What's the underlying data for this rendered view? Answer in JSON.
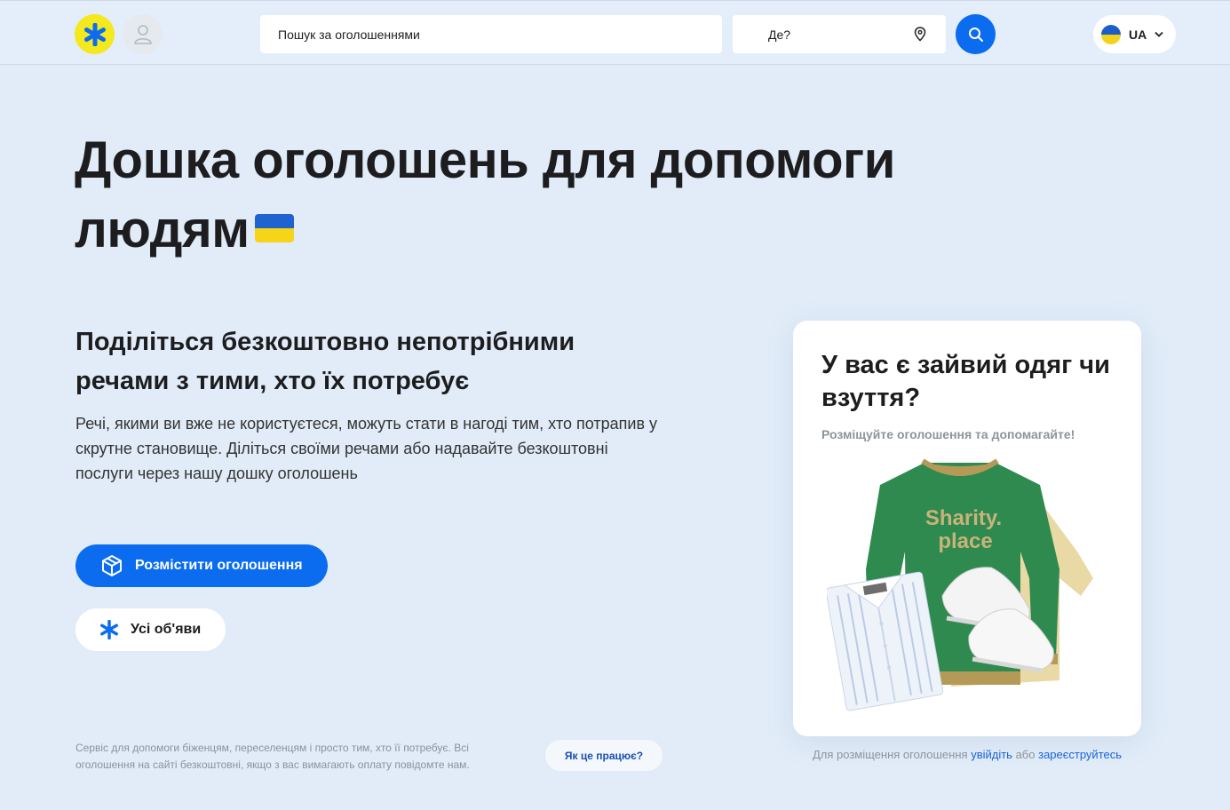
{
  "header": {
    "search_placeholder": "Пошук за оголошеннями",
    "location_placeholder": "Де?",
    "language": "UA",
    "icons": {
      "logo": "asterisk-logo-icon",
      "user": "user-icon",
      "pin": "map-pin-icon",
      "search": "search-icon",
      "language_flag": "ukraine-flag-icon",
      "dropdown": "chevron-down-icon"
    }
  },
  "hero": {
    "title_line1": "Дошка оголошень для допомоги",
    "title_line2": "людям"
  },
  "intro": {
    "subtitle": "Поділіться безкоштовно непотрібними речами з тими, хто їх потребує",
    "description": "Речі, якими ви вже не користуєтеся, можуть стати в нагоді тим, хто потрапив у скрутне становище. Діліться своїми речами або надавайте безкоштовні послуги через нашу дошку оголошень"
  },
  "actions": {
    "post_ad_label": "Розмістити оголошення",
    "all_ads_label": "Усі об'яви"
  },
  "footer": {
    "note": "Сервіс для допомоги біженцям, переселенцям і просто тим, хто її потребує. Всі оголошення на сайті безкоштовні, якщо з вас вимагають оплату повідомте нам.",
    "how_it_works_label": "Як це працює?"
  },
  "card": {
    "title": "У вас є зайвий одяг чи взуття?",
    "subtitle": "Розміщуйте оголошення та допомагайте!",
    "sweater_text_line1": "Sharity.",
    "sweater_text_line2": "place"
  },
  "login_note": {
    "prefix": "Для розміщення оголошення",
    "login_link": "увійдіть",
    "or": "або",
    "register_link": "зареєструйтесь"
  },
  "colors": {
    "accent": "#0b6cf0",
    "background": "#e1ecf8",
    "logo_yellow": "#f4e81f",
    "sweater_green": "#2e8a4f",
    "sweater_tan": "#b59a57"
  }
}
